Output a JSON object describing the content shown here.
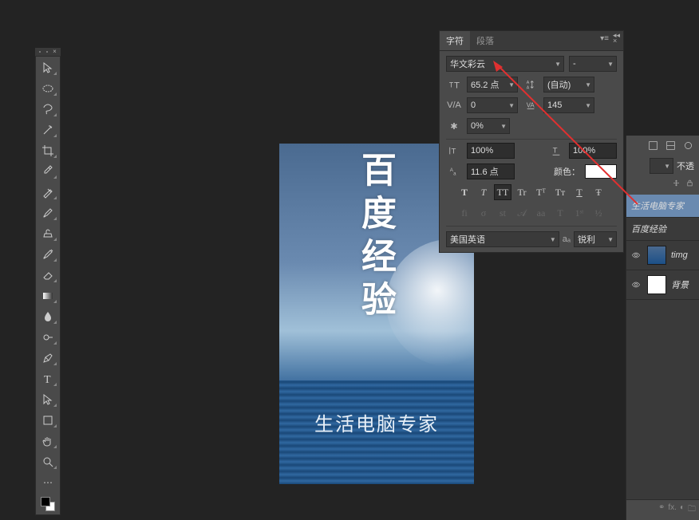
{
  "canvas": {
    "main_text": "百度经验",
    "sub_text": "生活电脑专家"
  },
  "char_panel": {
    "tab_character": "字符",
    "tab_paragraph": "段落",
    "font_family": "华文彩云",
    "font_style": "-",
    "font_size": "65.2 点",
    "leading": "(自动)",
    "kerning": "0",
    "tracking": "145",
    "baseline_shift": "0%",
    "vscale": "100%",
    "hscale": "100%",
    "baseline": "11.6 点",
    "color_label": "颜色：",
    "style_T1": "T",
    "style_T2": "T",
    "style_TT": "TT",
    "style_Tr": "Tr",
    "style_Tu": "Tᵀ",
    "style_Td": "Tᴛ",
    "style_Tunder": "T",
    "style_Tstrike": "Ŧ",
    "ot_fi": "fi",
    "ot_sigma": "σ",
    "ot_st": "st",
    "ot_A": "𝒜",
    "ot_aa": "aa",
    "ot_Tlig": "T",
    "ot_1st": "1ˢᵗ",
    "ot_half": "½",
    "language": "美国英语",
    "aa_label": "aₐ",
    "antialias": "锐利"
  },
  "layers": {
    "opacity_label": "不透",
    "layer1_name": "生活电脑专家",
    "layer2_name": "百度经验",
    "layer3_name": "timg",
    "layer4_name": "背景",
    "link_icon": "⚭",
    "fx_label": "fx.",
    "mask_icon": "◐",
    "folder_icon": "🗀"
  }
}
